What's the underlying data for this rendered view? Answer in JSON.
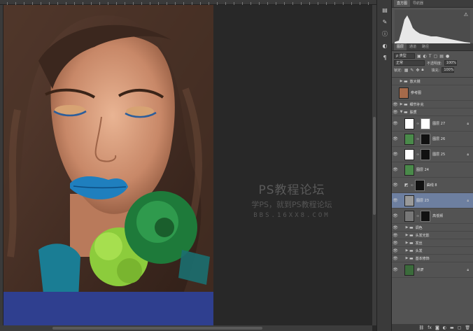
{
  "canvas": {
    "watermark_title": "PS教程论坛",
    "watermark_sub": "学PS，就到PS教程论坛",
    "watermark_url": "BBS.16XX8.COM"
  },
  "toolstrip": {
    "icons": [
      "history-icon",
      "brush-icon",
      "info-icon",
      "adjust-icon",
      "type-icon"
    ]
  },
  "histogram_panel": {
    "tabs": [
      "直方图",
      "导航器"
    ],
    "warning_glyph": "⚠"
  },
  "layers_panel": {
    "tabs": [
      "图层",
      "通道",
      "路径"
    ],
    "kind_filter": "ρ 类型",
    "blend_mode": "正常",
    "opacity_label": "不透明度:",
    "opacity_value": "100%",
    "lock_label": "锁定:",
    "fill_label": "填充:",
    "fill_value": "100%",
    "layers": [
      {
        "name": "放大镜",
        "type": "folder",
        "visible": false,
        "expanded": false
      },
      {
        "name": "参考图",
        "type": "image",
        "visible": false,
        "thumb": "#a56a4a"
      },
      {
        "name": "细节补充",
        "type": "folder",
        "visible": true,
        "expanded": false
      },
      {
        "name": "肤质",
        "type": "folder",
        "visible": true,
        "expanded": true
      },
      {
        "name": "图层 27",
        "type": "masked",
        "visible": true,
        "thumb": "#ffffff",
        "mask": "#ffffff",
        "locked": true
      },
      {
        "name": "图层 26",
        "type": "masked",
        "visible": true,
        "thumb": "#4a8a4a",
        "mask": "#111111"
      },
      {
        "name": "图层 25",
        "type": "masked",
        "visible": true,
        "thumb": "#ffffff",
        "mask": "#111111",
        "locked": true
      },
      {
        "name": "图层 24",
        "type": "image",
        "visible": true,
        "thumb": "#4a8a4a"
      },
      {
        "name": "曲线 8",
        "type": "adjustment",
        "visible": true,
        "mask": "#111111"
      },
      {
        "name": "图层 23",
        "type": "image",
        "visible": true,
        "selected": true,
        "thumb": "#999999",
        "locked": true
      },
      {
        "name": "高低频",
        "type": "masked",
        "visible": true,
        "thumb": "#777777",
        "mask": "#111111"
      },
      {
        "name": "调色",
        "type": "folder",
        "visible": true,
        "expanded": false
      },
      {
        "name": "头发光影",
        "type": "folder",
        "visible": true,
        "expanded": false
      },
      {
        "name": "发丝",
        "type": "folder",
        "visible": true,
        "expanded": false
      },
      {
        "name": "头发",
        "type": "folder",
        "visible": true,
        "expanded": false
      },
      {
        "name": "基本修饰",
        "type": "folder",
        "visible": true,
        "expanded": false
      },
      {
        "name": "背景",
        "type": "background",
        "visible": true,
        "thumb": "#3b6b3b",
        "locked": true
      }
    ],
    "footer_icons": [
      "link-icon",
      "fx-icon",
      "mask-icon",
      "adjustment-icon",
      "group-icon",
      "new-layer-icon",
      "trash-icon"
    ]
  },
  "colors": {
    "canvas_bg": "#282828",
    "panel_bg": "#535353",
    "selection": "#6d7fa0"
  }
}
